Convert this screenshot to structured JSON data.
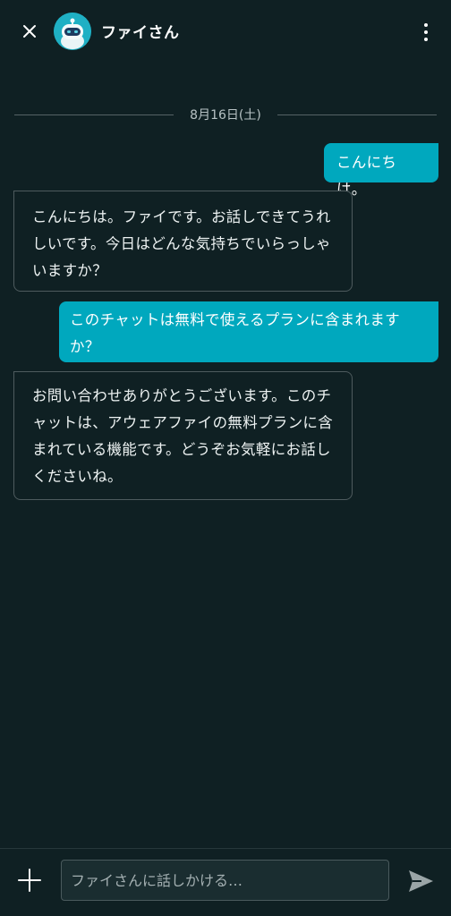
{
  "header": {
    "close_icon": "close-icon",
    "avatar_icon": "robot-avatar-icon",
    "title": "ファイさん",
    "more_icon": "more-vertical-icon"
  },
  "chat": {
    "date": "8月16日(土)",
    "messages": [
      {
        "sender": "user",
        "text": "こんにちは。"
      },
      {
        "sender": "bot",
        "text": "こんにちは。ファイです。お話しできてうれしいです。今日はどんな気持ちでいらっしゃいますか？"
      },
      {
        "sender": "user",
        "text": "このチャットは無料で使えるプランに含まれますか？"
      },
      {
        "sender": "bot",
        "text": "お問い合わせありがとうございます。このチャットは、アウェアファイの無料プランに含まれている機能です。どうぞお気軽にお話しくださいね。"
      }
    ]
  },
  "composer": {
    "add_icon": "plus-icon",
    "placeholder": "ファイさんに話しかける…",
    "value": "",
    "send_icon": "send-icon"
  },
  "colors": {
    "background": "#0f2023",
    "accent": "#00a8be",
    "bot_border": "#4e5b5e"
  }
}
